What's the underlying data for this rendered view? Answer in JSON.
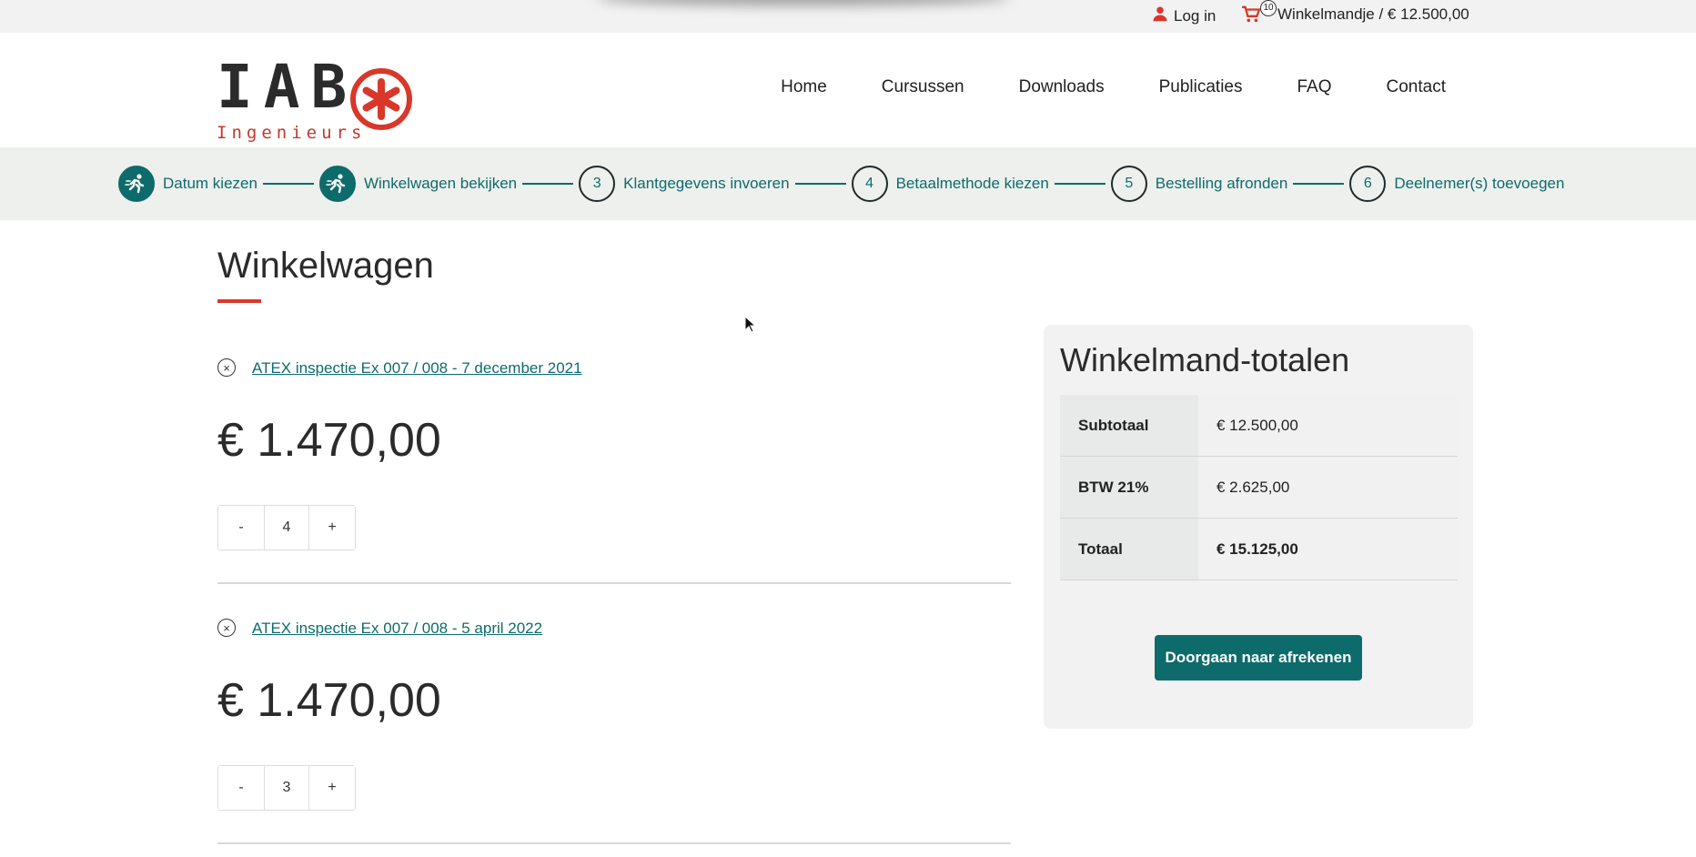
{
  "topbar": {
    "login_label": "Log in",
    "cart_label": "Winkelmandje / € 12.500,00",
    "cart_count": "10"
  },
  "logo": {
    "letters": "IAB",
    "subtitle": "Ingenieurs"
  },
  "nav": {
    "items": [
      "Home",
      "Cursussen",
      "Downloads",
      "Publicaties",
      "FAQ",
      "Contact"
    ]
  },
  "stepper": {
    "steps": [
      {
        "number": "",
        "label": "Datum kiezen",
        "done": true
      },
      {
        "number": "",
        "label": "Winkelwagen bekijken",
        "done": true
      },
      {
        "number": "3",
        "label": "Klantgegevens invoeren",
        "done": false
      },
      {
        "number": "4",
        "label": "Betaalmethode kiezen",
        "done": false
      },
      {
        "number": "5",
        "label": "Bestelling afronden",
        "done": false
      },
      {
        "number": "6",
        "label": "Deelnemer(s) toevoegen",
        "done": false
      }
    ]
  },
  "main": {
    "title": "Winkelwagen",
    "items": [
      {
        "name": "ATEX inspectie Ex 007 / 008 - 7 december 2021",
        "price": "€ 1.470,00",
        "qty": "4",
        "minus": "-",
        "plus": "+",
        "remove": "×"
      },
      {
        "name": "ATEX inspectie Ex 007 / 008 - 5 april 2022",
        "price": "€ 1.470,00",
        "qty": "3",
        "minus": "-",
        "plus": "+",
        "remove": "×"
      }
    ]
  },
  "totals": {
    "title": "Winkelmand-totalen",
    "rows": [
      {
        "label": "Subtotaal",
        "value": "€ 12.500,00"
      },
      {
        "label": "BTW 21%",
        "value": "€ 2.625,00"
      },
      {
        "label": "Totaal",
        "value": "€ 15.125,00"
      }
    ],
    "checkout_label": "Doorgaan naar afrekenen"
  },
  "colors": {
    "accent": "#0e6b6b",
    "brand_red": "#d9372a"
  }
}
